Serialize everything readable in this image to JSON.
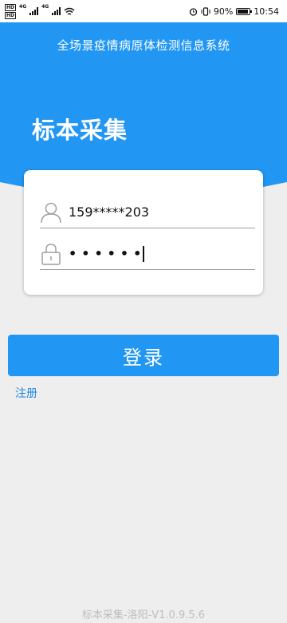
{
  "status_bar": {
    "sim1": "HD",
    "sim2": "HD",
    "network1": "4G",
    "network2": "4G",
    "battery": "90%",
    "time": "10:54"
  },
  "header": {
    "title": "全场景疫情病原体检测信息系统"
  },
  "page": {
    "title": "标本采集"
  },
  "login_form": {
    "username_value": "159*****203",
    "password_value": "••••••",
    "login_label": "登录",
    "register_label": "注册"
  },
  "footer": {
    "version": "标本采集-洛阳-V1.0.9.5.6"
  },
  "colors": {
    "primary": "#2196f3",
    "background": "#eeeeee",
    "link": "#1e88e5"
  },
  "icons": {
    "username": "user-icon",
    "password": "lock-icon"
  }
}
